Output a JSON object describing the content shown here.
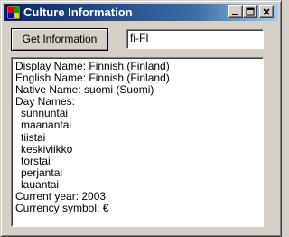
{
  "window": {
    "title": "Culture Information"
  },
  "title_buttons": {
    "minimize": "minimize-icon",
    "maximize": "maximize-icon",
    "close": "close-icon"
  },
  "form": {
    "get_button_label": "Get Information",
    "culture_value": "fi-FI"
  },
  "output": {
    "display_name": "Display Name: Finnish (Finland)",
    "english_name": "English Name: Finnish (Finland)",
    "native_name": "Native Name: suomi (Suomi)",
    "day_names_label": "Day Names:",
    "day_names": [
      "sunnuntai",
      "maanantai",
      "tiistai",
      "keskiviikko",
      "torstai",
      "perjantai",
      "lauantai"
    ],
    "current_year": "Current year: 2003",
    "currency_symbol": "Currency symbol: €"
  }
}
